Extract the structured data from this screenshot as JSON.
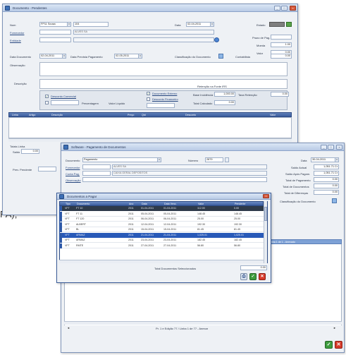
{
  "left_fragment": "PA);",
  "back_window": {
    "title": "Documento - Pendentes",
    "fields": {
      "num_label": "Num",
      "num_value": "FP11 Sousa",
      "num_value2": "104",
      "date_label": "Data",
      "date_value": "02-04-2011",
      "estado_label": "Estado",
      "fornecedor_label": "Fornecedor",
      "fornecedor_value": "ALVES SA",
      "entidade_label": "Entidade",
      "moeda_label": "Moeda",
      "valor_label": "Valor",
      "valor_value": "0.00",
      "prazo_label": "Prazo de Pag.",
      "cambio_value": "1.00",
      "doc_date_label": "Data Documento",
      "doc_date_value": "02-04-2011",
      "pay_date_label": "Data Prevista Pagamento",
      "pay_date_value": "02-05-2011",
      "class_label": "Classificação do Documento",
      "contabil_label": "Contabilista",
      "contabil_value": "0.00",
      "obs_label": "Observação",
      "descricao_label": "Descrição",
      "obs_label2": "Observação",
      "retencao_label": "Retenção na Fonte IRS",
      "base_label": "Base Incidência",
      "base_value": "1,000.00",
      "taxa_label": "Taxa Retenção",
      "taxa_value": "0.00",
      "total_label": "Total Calculado",
      "total_value": "0.00",
      "chk1_label": "Desconto Comercial",
      "chk2_label": "Desconto Financeiro",
      "chk3_label": "Documento Externo",
      "percent_label": "Percentagem",
      "valor2_label": "Valor Líquido",
      "grid_cols": [
        "Linha",
        "Artigo",
        "Descrição",
        "Preço",
        "Qtd",
        "Desconto",
        "Valor"
      ],
      "totals_label": "Totais Linha",
      "saldo_label": "Saldo",
      "saldo_value": "0.00",
      "pendente_label": "Prev. Pendente"
    }
  },
  "middle_window": {
    "title": "Software - Pagamento de Documentos",
    "documento_label": "Documento",
    "documento_value": "Pagamento",
    "numero_label": "Número",
    "numero_value": "2879",
    "data_label": "Data",
    "data_value": "30-04-2011",
    "fornecedor_label": "Fornecedor",
    "fornecedor_value": "ALVES SA",
    "conta_label": "Conta Pag.",
    "conta_value": "CAIXA GERAL DEPOSITOS",
    "observ_label": "Observação",
    "summary": [
      {
        "label": "Saldo Actual",
        "value": "1,051.71 Cr"
      },
      {
        "label": "Saldo Após Pagam.",
        "value": "1,051.71 Cr"
      },
      {
        "label": "Total de Pagamento",
        "value": "0.00"
      },
      {
        "label": "Total de Documentos",
        "value": "0.00"
      },
      {
        "label": "Total de Diferenças",
        "value": "0.00"
      }
    ],
    "class_label": "Classificação do Documento",
    "status_right": "Linha 1 de 1 - Anexado",
    "nav_text": "Pr. 1 e Edição 77 / Linha 1 de 77 - Anexar",
    "nav_prev": "◄",
    "nav_next": "►"
  },
  "front_window": {
    "title": "Documentos a Pagar",
    "columns": [
      "Tipo",
      "Documento",
      "Ano",
      "Data",
      "Data Venc.",
      "Valor",
      "Pendente"
    ],
    "rows": [
      {
        "tipo": "VFT",
        "doc": "FT 10",
        "ano": "2011",
        "data": "01-04-2011",
        "venc": "01-04-2011",
        "valor": "112.00",
        "pend": "0.00",
        "style": "dark"
      },
      {
        "tipo": "VFT",
        "doc": "FT 11",
        "ano": "2011",
        "data": "05-04-2011",
        "venc": "05-04-2011",
        "valor": "148.45",
        "pend": "148.45",
        "style": "normal"
      },
      {
        "tipo": "VFT",
        "doc": "FT 120",
        "ano": "2011",
        "data": "06-04-2011",
        "venc": "06-04-2011",
        "valor": "25.00",
        "pend": "25.00",
        "style": "normal"
      },
      {
        "tipo": "VFT",
        "doc": "ALBERT",
        "ano": "2011",
        "data": "12-04-2011",
        "venc": "12-04-2011",
        "valor": "192.30",
        "pend": "192.30",
        "style": "normal"
      },
      {
        "tipo": "VFT",
        "doc": "BL",
        "ano": "2011",
        "data": "15-04-2011",
        "venc": "15-04-2011",
        "valor": "81.45",
        "pend": "81.45",
        "style": "normal"
      },
      {
        "tipo": "VFT",
        "doc": "ARMAZ",
        "ano": "2011",
        "data": "21-04-2011",
        "venc": "21-04-2011",
        "valor": "1,025.01",
        "pend": "1,025.01",
        "style": "selected"
      },
      {
        "tipo": "VFT",
        "doc": "ARMAZ",
        "ano": "2011",
        "data": "23-04-2011",
        "venc": "23-04-2011",
        "valor": "182.45",
        "pend": "182.45",
        "style": "normal"
      },
      {
        "tipo": "VFT",
        "doc": "RMTE",
        "ano": "2011",
        "data": "27-04-2011",
        "venc": "27-04-2011",
        "valor": "56.80",
        "pend": "56.80",
        "style": "normal"
      }
    ],
    "total_label": "Total Documentos Seleccionados",
    "total_value": "0.00"
  }
}
